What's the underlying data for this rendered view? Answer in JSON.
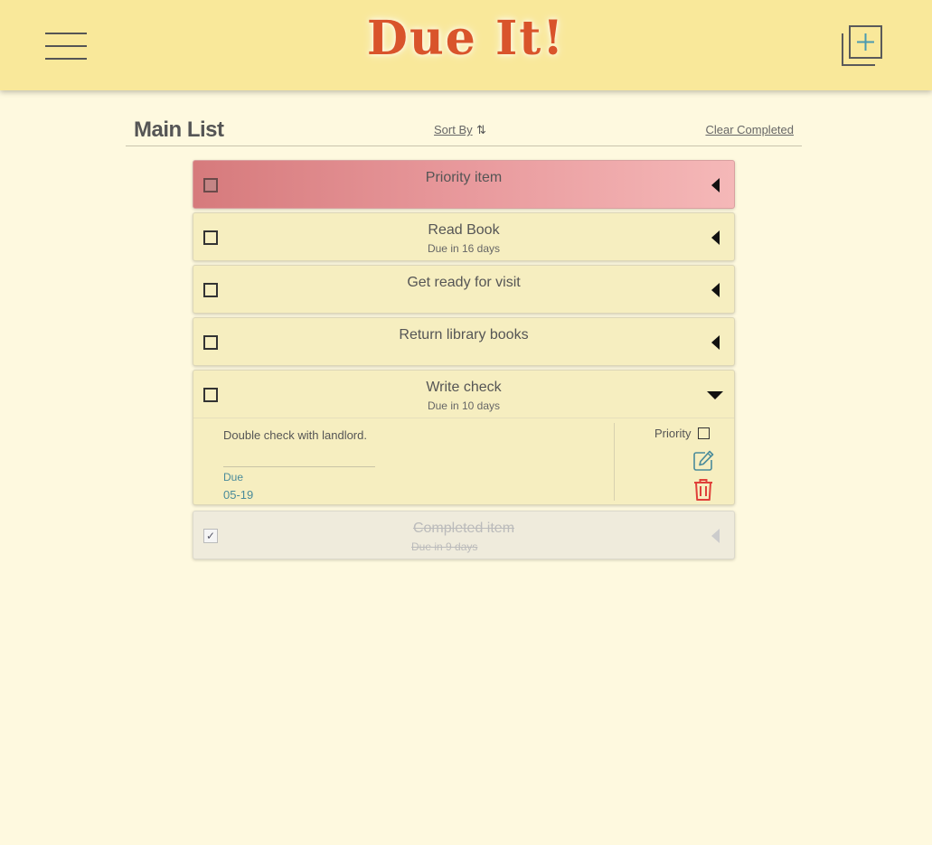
{
  "header": {
    "logo": "Due It!",
    "menu_icon": "hamburger-menu-icon",
    "add_icon": "add-list-icon"
  },
  "list": {
    "title": "Main List",
    "sort_label": "Sort By",
    "sort_icon": "⇅",
    "clear_label": "Clear Completed"
  },
  "items": [
    {
      "title": "Priority item",
      "due": "",
      "priority": true,
      "completed": false
    },
    {
      "title": "Read Book",
      "due": "Due in 16 days",
      "priority": false,
      "completed": false
    },
    {
      "title": "Get ready for visit",
      "due": "",
      "priority": false,
      "completed": false
    },
    {
      "title": "Return library books",
      "due": "",
      "priority": false,
      "completed": false
    },
    {
      "title": "Write check",
      "due": "Due in 10 days",
      "priority": false,
      "completed": false,
      "expanded": true,
      "notes": "Double check with landlord.",
      "due_label": "Due",
      "due_date": "05-19",
      "priority_label": "Priority"
    },
    {
      "title": "Completed item",
      "due": "Due in 9 days",
      "priority": false,
      "completed": true,
      "check_mark": "✓"
    }
  ],
  "colors": {
    "header_bg": "#f9e89a",
    "page_bg": "#fef9df",
    "logo": "#d9542b",
    "accent_teal": "#4a8b9a",
    "delete_red": "#e0403a"
  }
}
